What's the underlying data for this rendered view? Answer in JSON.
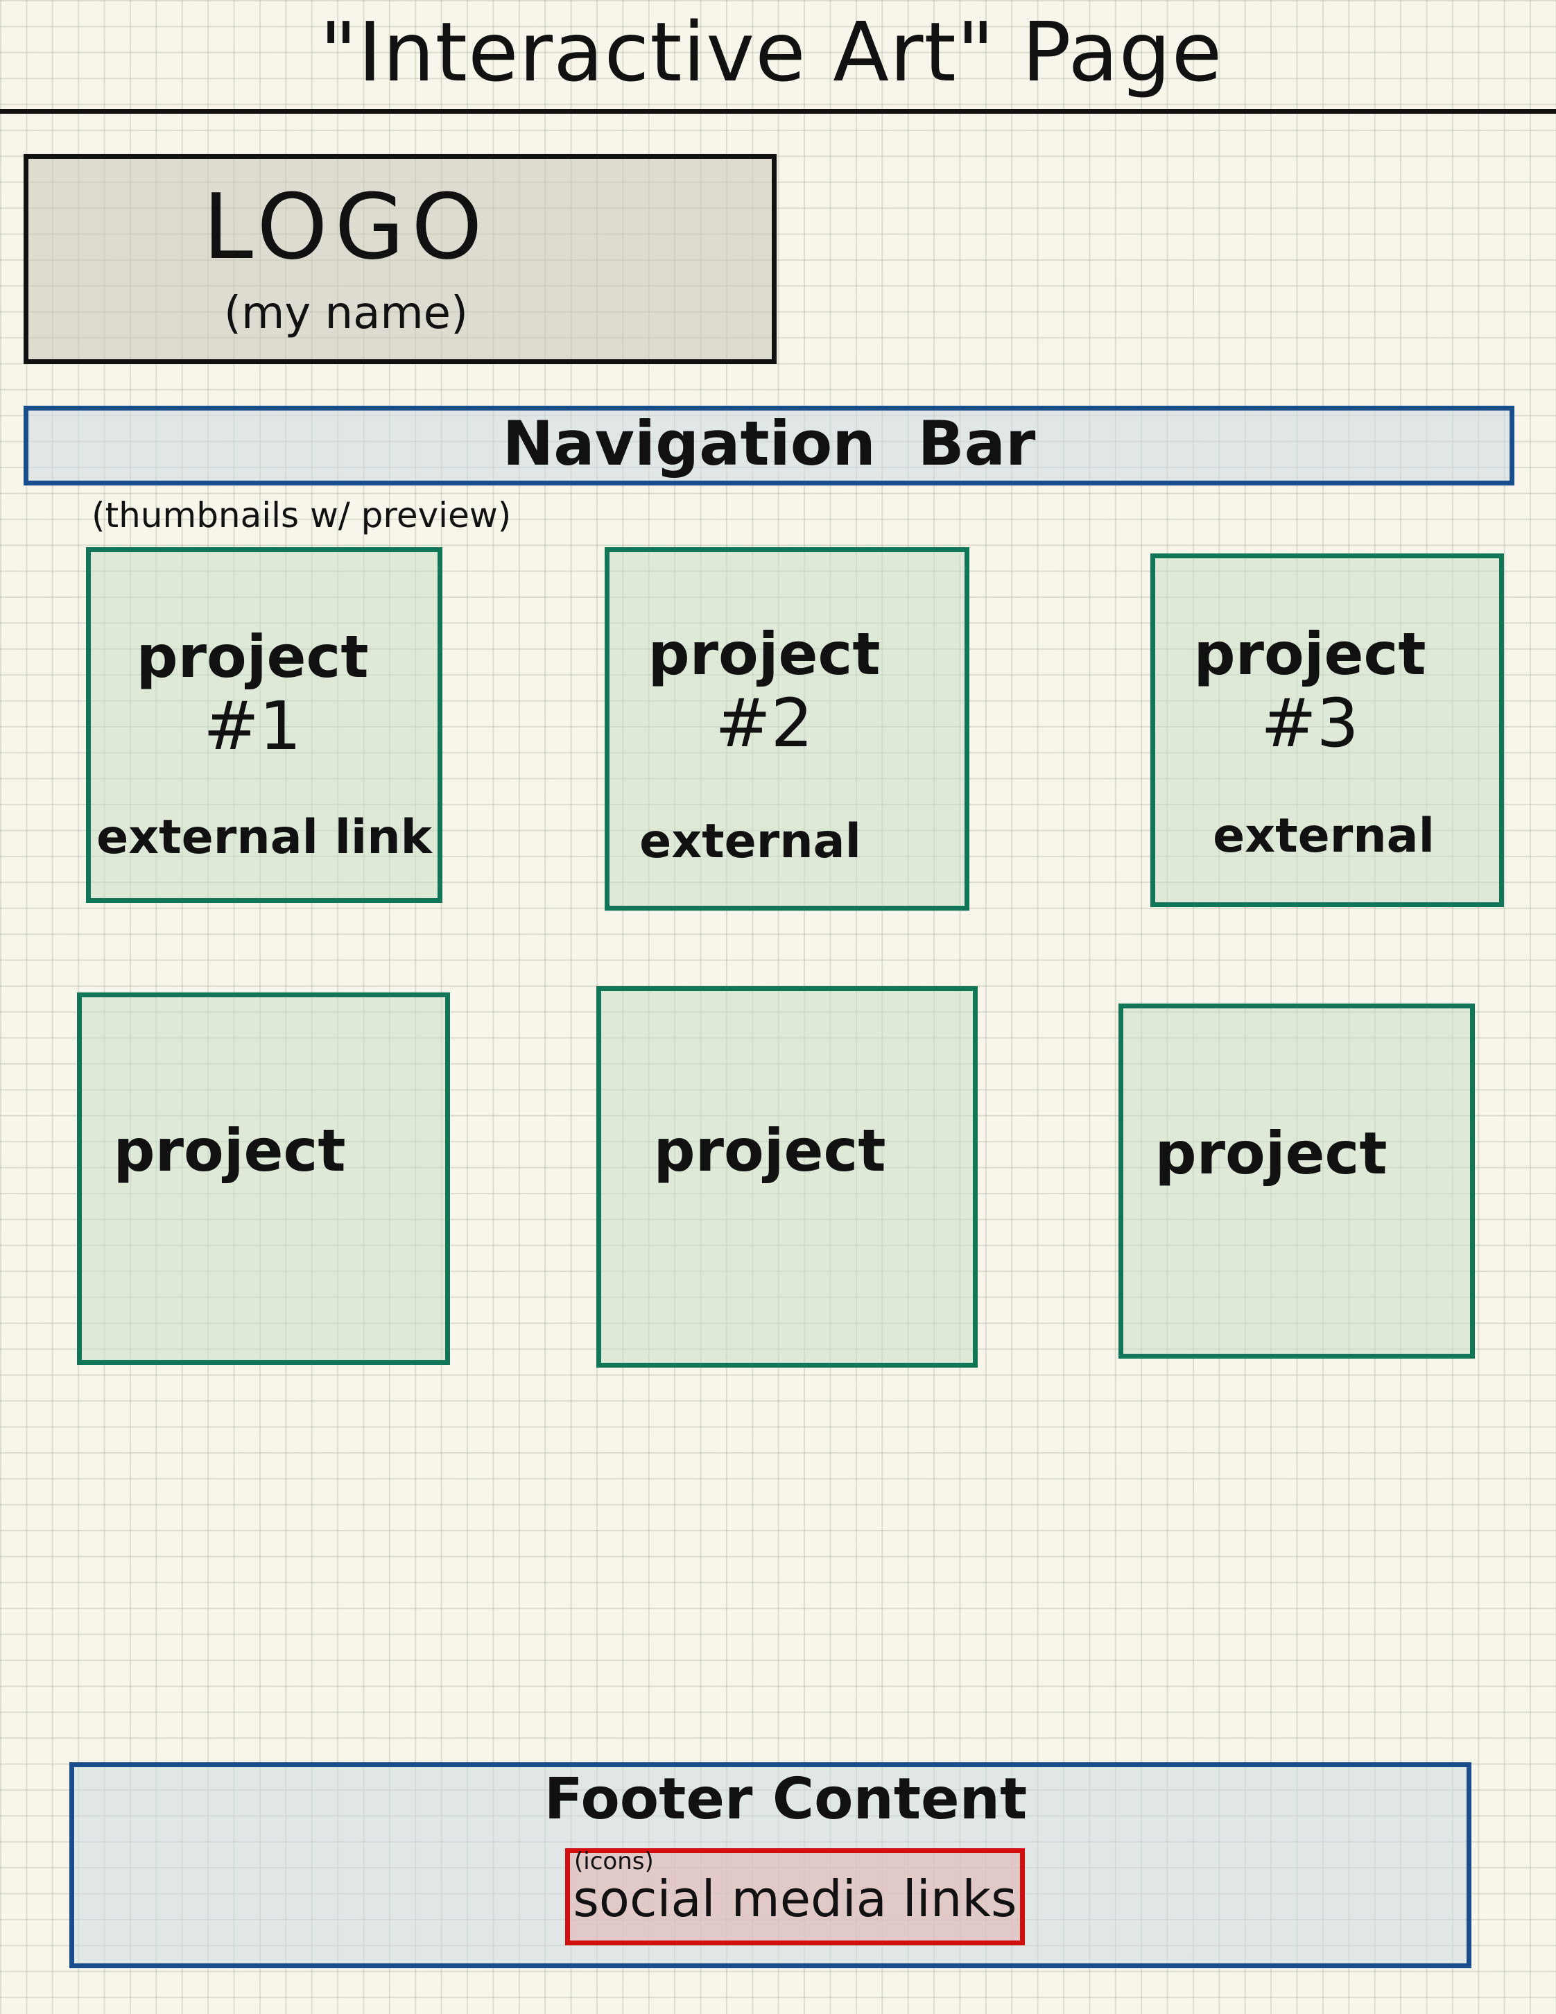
{
  "page": {
    "title": "\"Interactive Art\" Page"
  },
  "logo": {
    "text": "LOGO",
    "subtext": "(my name)"
  },
  "nav": {
    "label": "Navigation Bar"
  },
  "thumbnails": {
    "note": "(thumbnails w/ preview)"
  },
  "projects": [
    {
      "label": "project",
      "number": "#1",
      "link": "external link"
    },
    {
      "label": "project",
      "number": "#2",
      "link": "external"
    },
    {
      "label": "project",
      "number": "#3",
      "link": "external"
    },
    {
      "label": "project"
    },
    {
      "label": "project"
    },
    {
      "label": "project"
    }
  ],
  "footer": {
    "title": "Footer Content",
    "social_note": "(icons)",
    "social_label": "social media links"
  },
  "colors": {
    "header_box": "#111111",
    "nav_and_footer": "#1a4d8c",
    "project_tiles": "#117558",
    "social_links": "#d10f0f"
  }
}
